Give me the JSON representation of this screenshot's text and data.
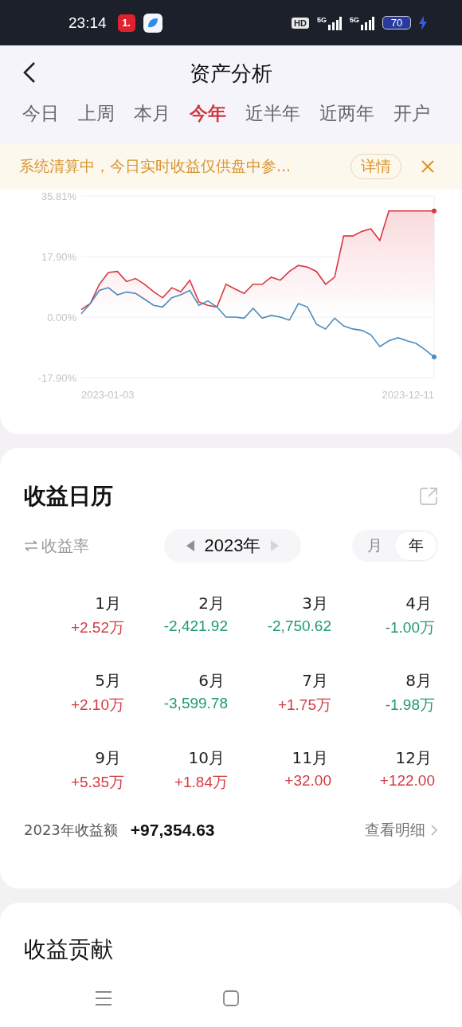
{
  "status_bar": {
    "time": "23:14",
    "app_badge": "1.",
    "hd": "HD",
    "signals": [
      "5G",
      "5G"
    ],
    "battery": "70"
  },
  "header": {
    "title": "资产分析"
  },
  "tabs": [
    {
      "label": "今日",
      "selected": false
    },
    {
      "label": "上周",
      "selected": false
    },
    {
      "label": "本月",
      "selected": false
    },
    {
      "label": "今年",
      "selected": true
    },
    {
      "label": "近半年",
      "selected": false
    },
    {
      "label": "近两年",
      "selected": false
    },
    {
      "label": "开户",
      "selected": false
    }
  ],
  "notice": {
    "text": "系统清算中，今日实时收益仅供盘中参...",
    "button": "详情"
  },
  "chart": {
    "date_start": "2023-01-03",
    "date_end": "2023-12-11",
    "chart_data": {
      "type": "line",
      "ylim": [
        -17.9,
        35.81
      ],
      "yticks": [
        {
          "value": 35.81,
          "label": "35.81%"
        },
        {
          "value": 17.9,
          "label": "17.90%"
        },
        {
          "value": 0,
          "label": "0.00%"
        },
        {
          "value": -17.9,
          "label": "-17.90%"
        }
      ],
      "series": [
        {
          "color": "#d9363e",
          "type": "area",
          "values": [
            2.2,
            4,
            9.7,
            13.2,
            13.5,
            10.5,
            11.4,
            9.7,
            7.5,
            5.7,
            8.7,
            7.5,
            10.9,
            4.5,
            3.5,
            3,
            9.7,
            8.3,
            7,
            9.7,
            9.7,
            11.8,
            10.9,
            13.5,
            15.3,
            14.8,
            13.5,
            9.7,
            11.8,
            24,
            24,
            25.3,
            26.1,
            22.7,
            31.4,
            31.4,
            31.4,
            31.4,
            31.4,
            31.4
          ]
        },
        {
          "color": "#4a8cc0",
          "type": "line",
          "values": [
            1,
            4,
            7.9,
            8.7,
            6.6,
            7.4,
            7,
            5.3,
            3.5,
            3,
            5.7,
            6.6,
            7.9,
            3.5,
            4.8,
            3,
            0,
            0,
            -0.3,
            2.6,
            -0.3,
            0.5,
            0,
            -0.9,
            4,
            3,
            -2.1,
            -3.5,
            -0.3,
            -2.6,
            -3.5,
            -3.9,
            -5.2,
            -8.7,
            -7,
            -6.1,
            -7,
            -7.8,
            -9.6,
            -11.8
          ]
        }
      ]
    }
  },
  "calendar": {
    "title": "收益日历",
    "metric": "收益率",
    "year": "2023年",
    "modes": [
      {
        "label": "月",
        "selected": false
      },
      {
        "label": "年",
        "selected": true
      }
    ],
    "months": [
      {
        "month": "1月",
        "value": "+2.52万",
        "kind": "gain"
      },
      {
        "month": "2月",
        "value": "-2,421.92",
        "kind": "loss"
      },
      {
        "month": "3月",
        "value": "-2,750.62",
        "kind": "loss"
      },
      {
        "month": "4月",
        "value": "-1.00万",
        "kind": "loss"
      },
      {
        "month": "5月",
        "value": "+2.10万",
        "kind": "gain"
      },
      {
        "month": "6月",
        "value": "-3,599.78",
        "kind": "loss"
      },
      {
        "month": "7月",
        "value": "+1.75万",
        "kind": "gain"
      },
      {
        "month": "8月",
        "value": "-1.98万",
        "kind": "loss"
      },
      {
        "month": "9月",
        "value": "+5.35万",
        "kind": "gain"
      },
      {
        "month": "10月",
        "value": "+1.84万",
        "kind": "gain"
      },
      {
        "month": "11月",
        "value": "+32.00",
        "kind": "gain"
      },
      {
        "month": "12月",
        "value": "+122.00",
        "kind": "gain"
      }
    ],
    "total_label": "2023年收益额",
    "total_value": "+97,354.63",
    "details_link": "查看明细"
  },
  "contribution": {
    "title": "收益贡献"
  }
}
